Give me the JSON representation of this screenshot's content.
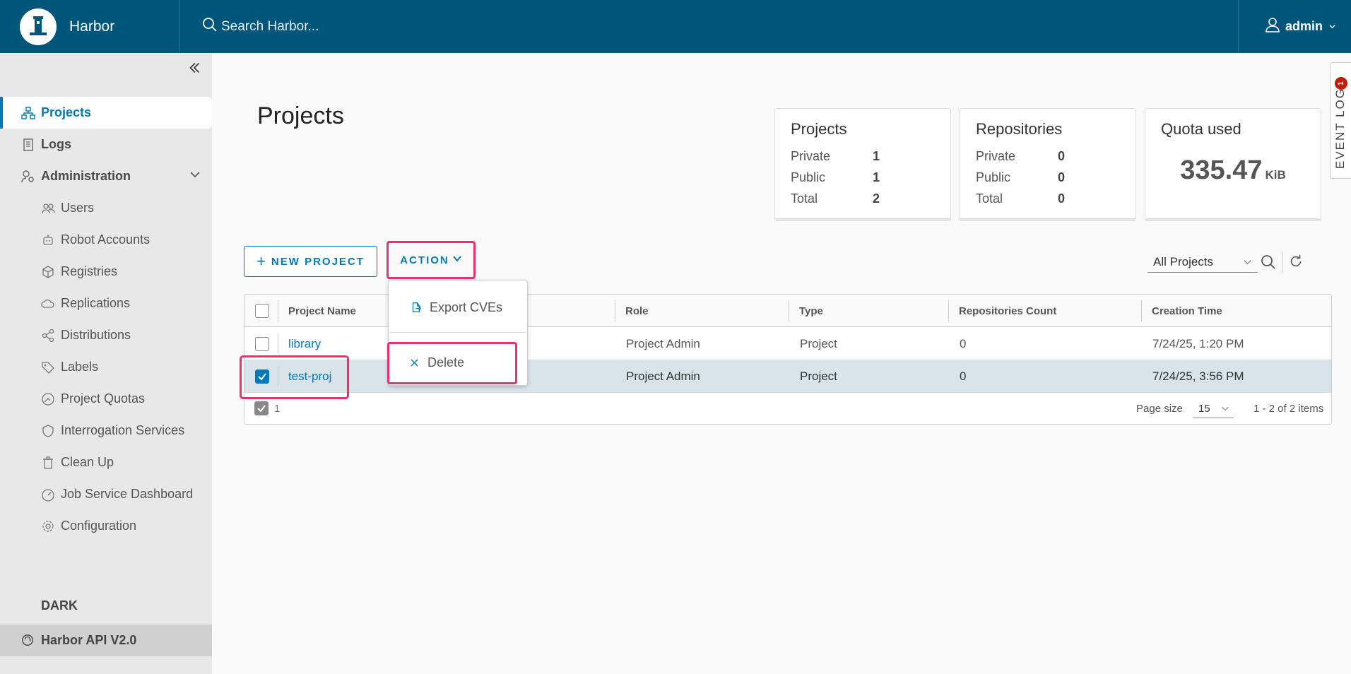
{
  "app": {
    "name": "Harbor"
  },
  "header": {
    "search_placeholder": "Search Harbor...",
    "user_name": "admin"
  },
  "sidebar": {
    "items": [
      {
        "label": "Projects",
        "icon": "projects-icon"
      },
      {
        "label": "Logs",
        "icon": "logs-icon"
      },
      {
        "label": "Administration",
        "icon": "administration-icon"
      }
    ],
    "admin_items": [
      {
        "label": "Users",
        "icon": "users-icon"
      },
      {
        "label": "Robot Accounts",
        "icon": "robot-icon"
      },
      {
        "label": "Registries",
        "icon": "registries-icon"
      },
      {
        "label": "Replications",
        "icon": "replications-icon"
      },
      {
        "label": "Distributions",
        "icon": "distributions-icon"
      },
      {
        "label": "Labels",
        "icon": "labels-icon"
      },
      {
        "label": "Project Quotas",
        "icon": "quotas-icon"
      },
      {
        "label": "Interrogation Services",
        "icon": "shield-icon"
      },
      {
        "label": "Clean Up",
        "icon": "trash-icon"
      },
      {
        "label": "Job Service Dashboard",
        "icon": "dashboard-icon"
      },
      {
        "label": "Configuration",
        "icon": "gear-icon"
      }
    ],
    "dark_label": "DARK",
    "api_label": "Harbor API V2.0"
  },
  "main": {
    "title": "Projects",
    "cards": {
      "projects": {
        "title": "Projects",
        "private_label": "Private",
        "private": "1",
        "public_label": "Public",
        "public": "1",
        "total_label": "Total",
        "total": "2"
      },
      "repositories": {
        "title": "Repositories",
        "private_label": "Private",
        "private": "0",
        "public_label": "Public",
        "public": "0",
        "total_label": "Total",
        "total": "0"
      },
      "quota": {
        "title": "Quota used",
        "value": "335.47",
        "unit": "KiB"
      }
    },
    "toolbar": {
      "new_project": "NEW PROJECT",
      "action": "ACTION",
      "filter_value": "All Projects"
    },
    "action_menu": {
      "export": "Export CVEs",
      "delete": "Delete"
    },
    "table": {
      "headers": {
        "name": "Project Name",
        "role": "Role",
        "type": "Type",
        "repos": "Repositories Count",
        "created": "Creation Time"
      },
      "rows": [
        {
          "name": "library",
          "role": "Project Admin",
          "type": "Project",
          "repos": "0",
          "created": "7/24/25, 1:20 PM"
        },
        {
          "name": "test-proj",
          "role": "Project Admin",
          "type": "Project",
          "repos": "0",
          "created": "7/24/25, 3:56 PM"
        }
      ],
      "footer": {
        "selected_count": "1",
        "page_size_label": "Page size",
        "page_size": "15",
        "pager": "1 - 2 of 2 items"
      }
    }
  },
  "event_log": {
    "label": "EVENT LOG",
    "count": "1"
  },
  "colors": {
    "header": "#00567a",
    "accent": "#0079b8",
    "highlight": "#e8336a",
    "badge": "#c21d00"
  }
}
